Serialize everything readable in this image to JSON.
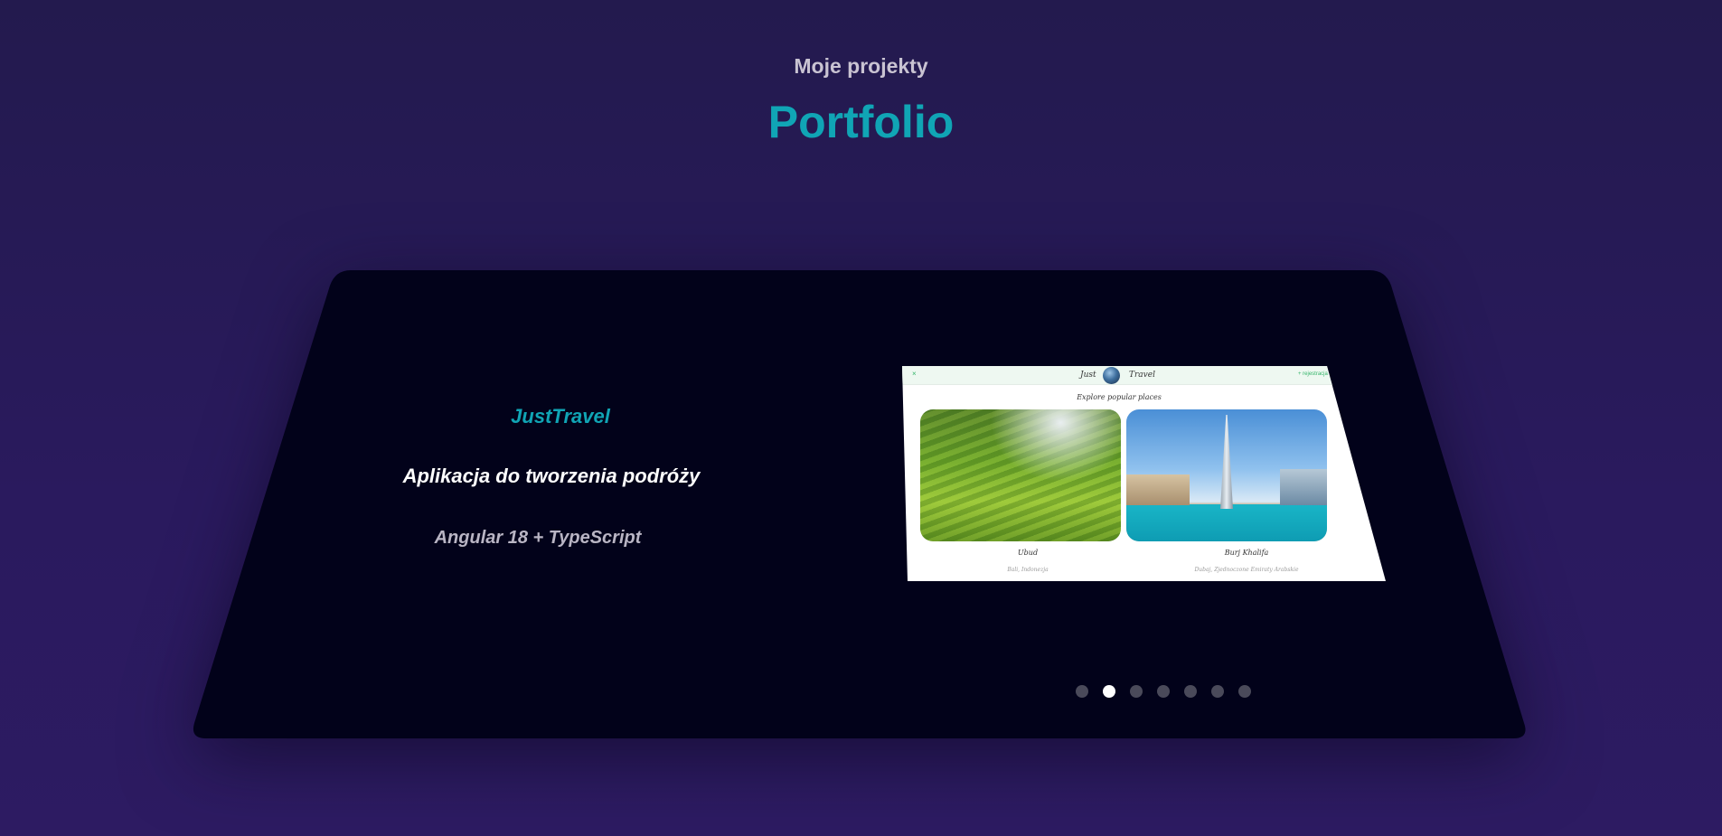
{
  "header": {
    "subtitle": "Moje projekty",
    "title": "Portfolio"
  },
  "project": {
    "name": "JustTravel",
    "description": "Aplikacja do tworzenia podróży",
    "tech": "Angular 18 + TypeScript"
  },
  "screenshot": {
    "close_icon": "×",
    "brand_left": "Just",
    "brand_right": "Travel",
    "register_label": "+ rejestracja",
    "heading": "Explore popular places",
    "places": [
      {
        "name": "Ubud",
        "location": "Bali, Indonezja"
      },
      {
        "name": "Burj Khalifa",
        "location": "Dubaj, Zjednoczone Emiraty Arabskie"
      }
    ]
  },
  "carousel": {
    "slide_count": 7,
    "active_index": 1
  },
  "colors": {
    "accent": "#10a5b5",
    "background": "#2a1a5e",
    "card": "#02021a"
  }
}
